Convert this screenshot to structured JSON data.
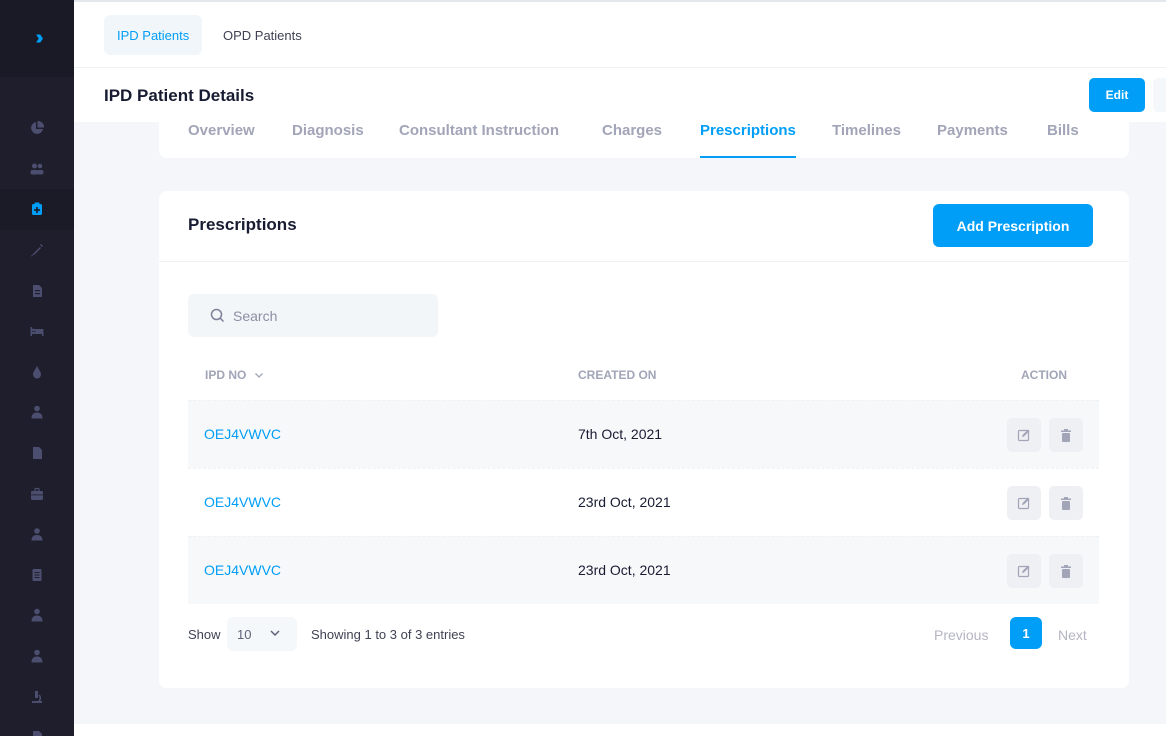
{
  "sidebar": {
    "toggle_icon": "double-chevron-right-icon",
    "items": [
      {
        "icon": "pie-chart-icon"
      },
      {
        "icon": "users-icon"
      },
      {
        "icon": "hospital-icon",
        "active": true
      },
      {
        "icon": "syringe-icon"
      },
      {
        "icon": "document-icon"
      },
      {
        "icon": "bed-icon"
      },
      {
        "icon": "blood-drop-icon"
      },
      {
        "icon": "doctor-icon"
      },
      {
        "icon": "file-icon"
      },
      {
        "icon": "briefcase-icon"
      },
      {
        "icon": "user-nurse-icon"
      },
      {
        "icon": "report-icon"
      },
      {
        "icon": "user-tie-icon"
      },
      {
        "icon": "user-md-icon"
      },
      {
        "icon": "microscope-icon"
      },
      {
        "icon": "file-medical-icon"
      }
    ]
  },
  "top_tabs": [
    {
      "label": "IPD Patients",
      "active": true
    },
    {
      "label": "OPD Patients",
      "active": false
    }
  ],
  "header": {
    "title": "IPD Patient Details",
    "edit_label": "Edit"
  },
  "sub_tabs": [
    {
      "label": "Overview"
    },
    {
      "label": "Diagnosis"
    },
    {
      "label": "Consultant Instruction"
    },
    {
      "label": "Charges"
    },
    {
      "label": "Prescriptions",
      "active": true
    },
    {
      "label": "Timelines"
    },
    {
      "label": "Payments"
    },
    {
      "label": "Bills"
    }
  ],
  "card": {
    "title": "Prescriptions",
    "add_button": "Add Prescription",
    "search_placeholder": "Search"
  },
  "table": {
    "columns": [
      "IPD NO",
      "CREATED ON",
      "ACTION"
    ],
    "rows": [
      {
        "ipd_no": "OEJ4VWVC",
        "created_on": "7th Oct, 2021"
      },
      {
        "ipd_no": "OEJ4VWVC",
        "created_on": "23rd Oct, 2021"
      },
      {
        "ipd_no": "OEJ4VWVC",
        "created_on": "23rd Oct, 2021"
      }
    ]
  },
  "footer": {
    "show_label": "Show",
    "page_size": "10",
    "entries_text": "Showing 1 to 3 of 3 entries",
    "previous": "Previous",
    "current_page": "1",
    "next": "Next"
  },
  "colors": {
    "accent": "#009ef7",
    "sidebar_bg": "#1e1e2d",
    "muted": "#a1a5b7"
  }
}
